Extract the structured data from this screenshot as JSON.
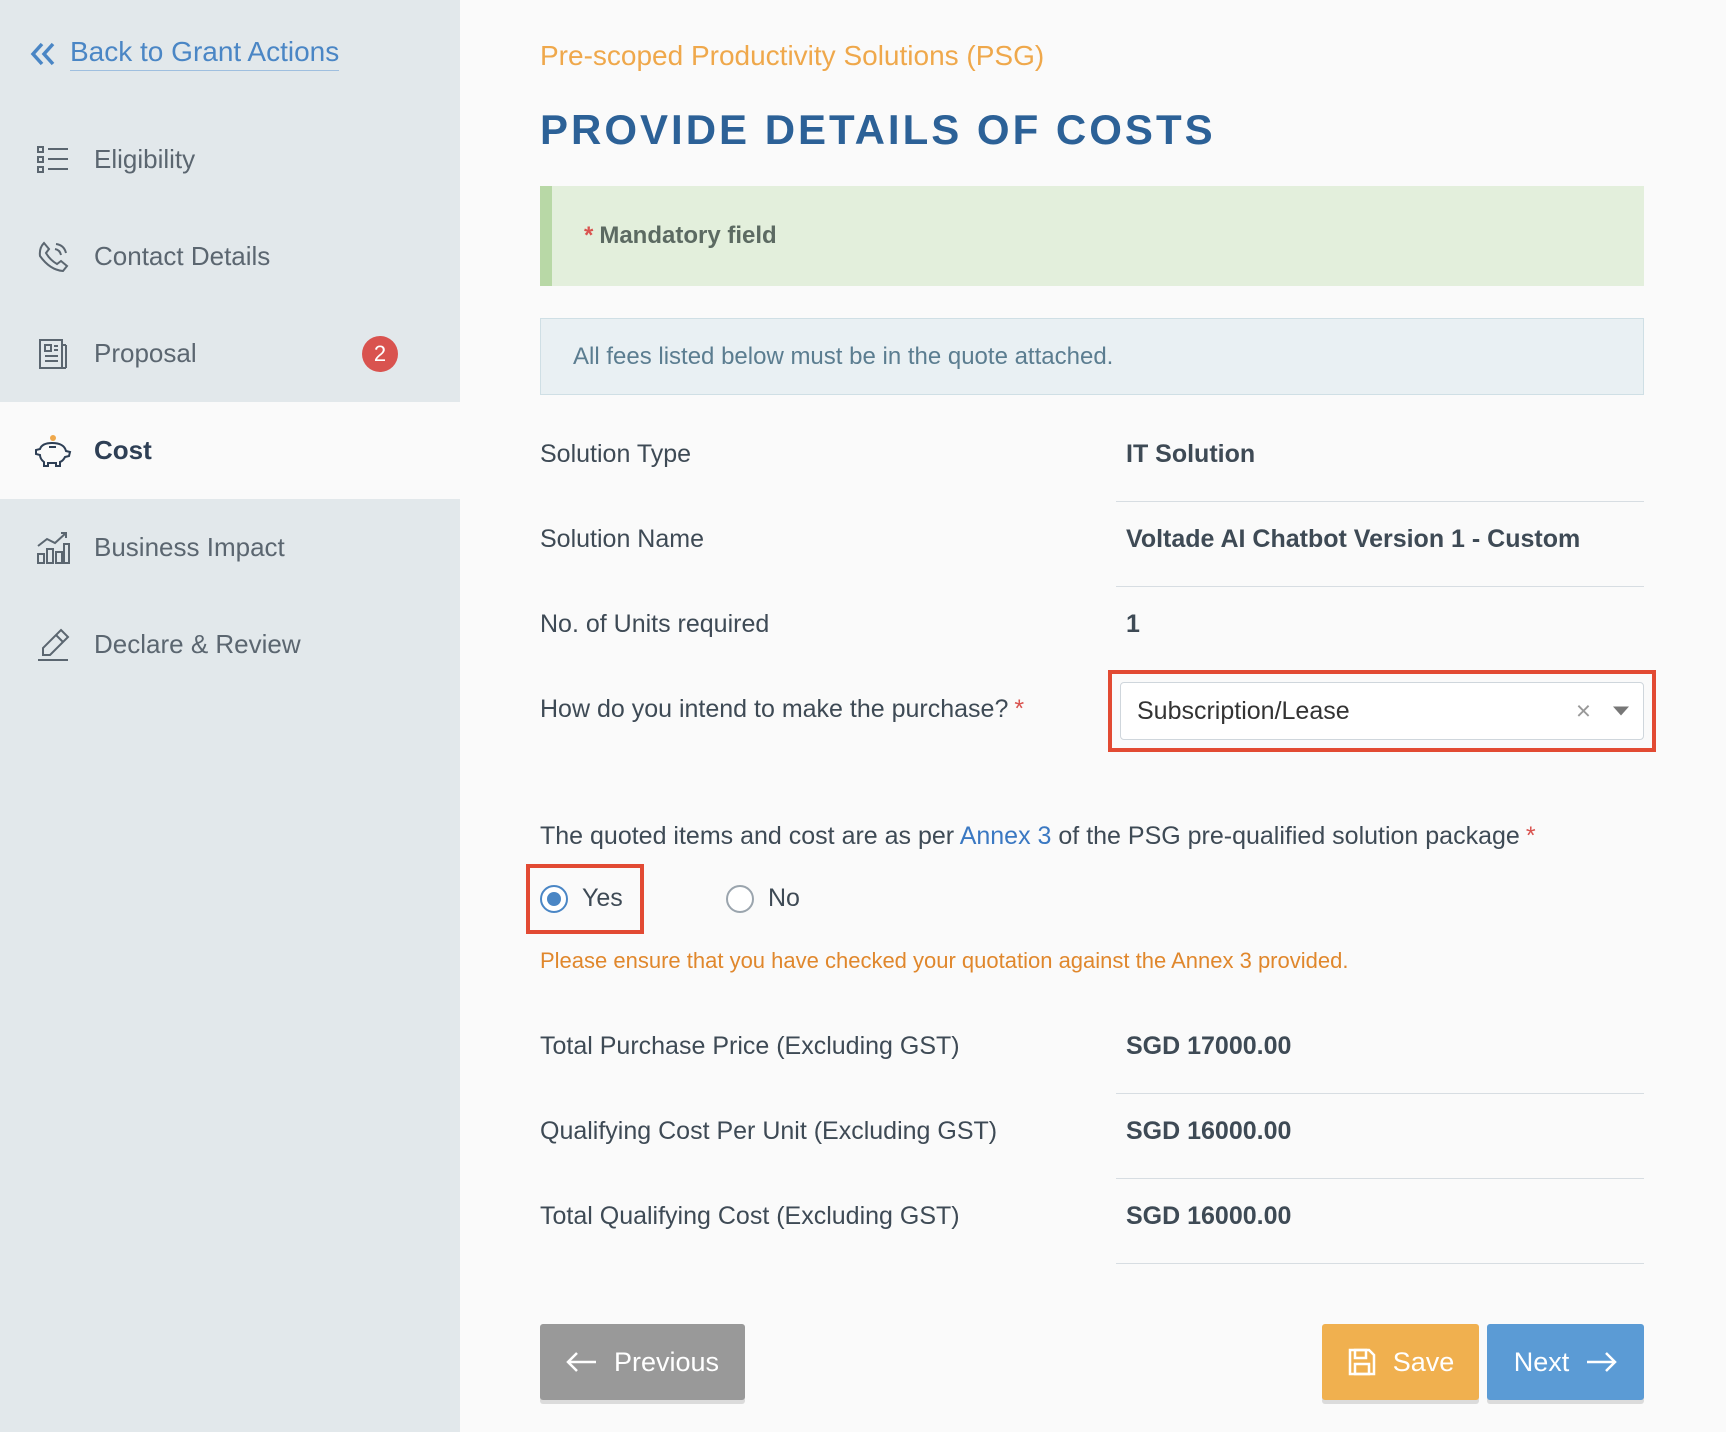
{
  "sidebar": {
    "back_label": "Back to Grant Actions",
    "items": [
      {
        "label": "Eligibility",
        "icon": "list-icon"
      },
      {
        "label": "Contact Details",
        "icon": "phone-icon"
      },
      {
        "label": "Proposal",
        "icon": "document-icon",
        "badge": "2"
      },
      {
        "label": "Cost",
        "icon": "piggy-bank-icon",
        "active": true
      },
      {
        "label": "Business Impact",
        "icon": "bar-chart-icon"
      },
      {
        "label": "Declare & Review",
        "icon": "pen-icon"
      }
    ]
  },
  "header": {
    "subtitle": "Pre-scoped Productivity Solutions (PSG)",
    "title": "PROVIDE DETAILS OF COSTS"
  },
  "notices": {
    "mandatory_star": "*",
    "mandatory": "Mandatory field",
    "info": "All fees listed below must be in the quote attached."
  },
  "fields": {
    "solution_type": {
      "label": "Solution Type",
      "value": "IT Solution"
    },
    "solution_name": {
      "label": "Solution Name",
      "value": "Voltade AI Chatbot Version 1 - Custom"
    },
    "units": {
      "label": "No. of Units required",
      "value": "1"
    },
    "purchase": {
      "label": "How do you intend to make the purchase?",
      "required": "*",
      "value": "Subscription/Lease",
      "clear": "×"
    },
    "annex": {
      "text_before": "The quoted items and cost are as per ",
      "link": "Annex 3",
      "text_after": " of the PSG pre-qualified solution package",
      "required": "*",
      "options": [
        "Yes",
        "No"
      ],
      "selected": "Yes",
      "warning": "Please ensure that you have checked your quotation against the Annex 3 provided."
    },
    "total_purchase": {
      "label": "Total Purchase Price (Excluding GST)",
      "value": "SGD 17000.00"
    },
    "qualifying_unit": {
      "label": "Qualifying Cost Per Unit (Excluding GST)",
      "value": "SGD 16000.00"
    },
    "total_qualifying": {
      "label": "Total Qualifying Cost (Excluding GST)",
      "value": "SGD 16000.00"
    }
  },
  "buttons": {
    "previous": "Previous",
    "save": "Save",
    "next": "Next"
  },
  "colors": {
    "accent": "#2c6197",
    "subtitle": "#efa84b",
    "highlight": "#e24a33",
    "badge": "#d9534f"
  }
}
